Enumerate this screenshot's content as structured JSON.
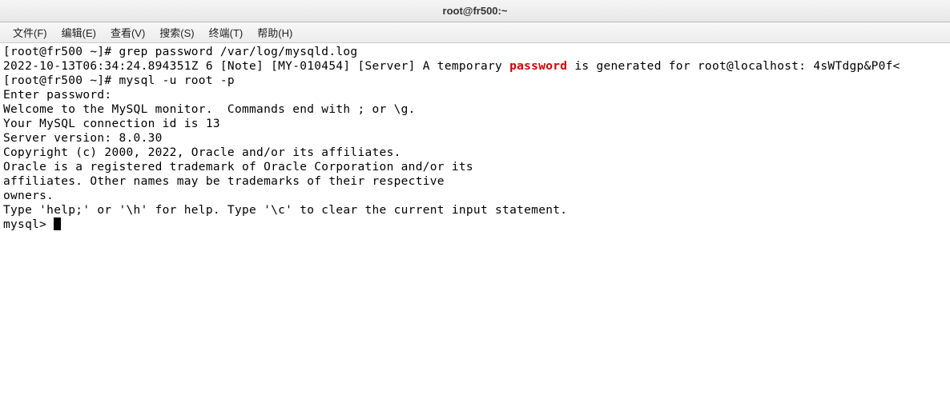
{
  "window": {
    "title": "root@fr500:~"
  },
  "menu": {
    "file": "文件(F)",
    "edit": "编辑(E)",
    "view": "查看(V)",
    "search": "搜索(S)",
    "terminal": "终端(T)",
    "help": "帮助(H)"
  },
  "terminal": {
    "line1": "[root@fr500 ~]# grep password /var/log/mysqld.log",
    "line2a": "2022-10-13T06:34:24.894351Z 6 [Note] [MY-010454] [Server] A temporary ",
    "line2_highlight": "password",
    "line2b": " is generated for root@localhost: 4sWTdgp&P0f<",
    "line3": "[root@fr500 ~]# mysql -u root -p",
    "line4": "Enter password:",
    "line5": "Welcome to the MySQL monitor.  Commands end with ; or \\g.",
    "line6": "Your MySQL connection id is 13",
    "line7": "Server version: 8.0.30",
    "line8": "",
    "line9": "Copyright (c) 2000, 2022, Oracle and/or its affiliates.",
    "line10": "",
    "line11": "Oracle is a registered trademark of Oracle Corporation and/or its",
    "line12": "affiliates. Other names may be trademarks of their respective",
    "line13": "owners.",
    "line14": "",
    "line15": "Type 'help;' or '\\h' for help. Type '\\c' to clear the current input statement.",
    "line16": "",
    "line17": "mysql> "
  }
}
